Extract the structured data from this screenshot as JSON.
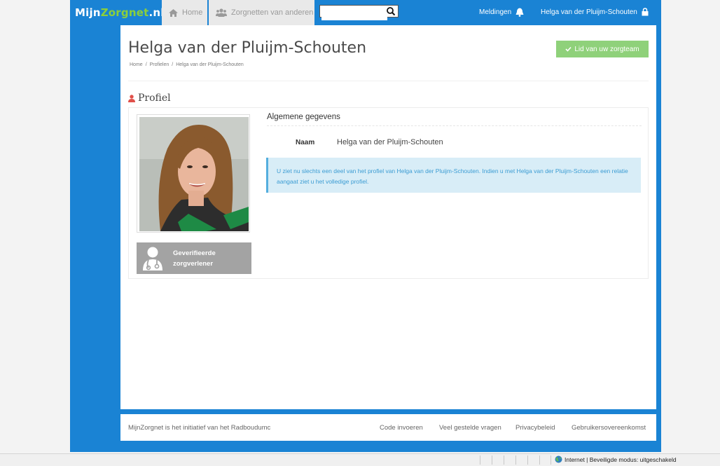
{
  "header": {
    "logo": {
      "part1": "Mijn",
      "part2": "Zorgnet",
      "part3": ".nl"
    },
    "nav": [
      {
        "label": "Home",
        "icon": "home-icon"
      },
      {
        "label": "Zorgnetten van anderen",
        "icon": "users-icon"
      }
    ],
    "search": {
      "value": "",
      "placeholder": ""
    },
    "notifications_label": "Meldingen",
    "user_label": "Helga van der Pluijm-Schouten"
  },
  "page": {
    "title": "Helga van der Pluijm-Schouten",
    "breadcrumb": [
      "Home",
      "Profielen",
      "Helga van der Pluijm-Schouten"
    ],
    "team_button": "Lid van uw zorgteam"
  },
  "profile": {
    "section_title": "Profiel",
    "verified_line1": "Geverifieerde",
    "verified_line2": "zorgverlener",
    "general_title": "Algemene gegevens",
    "name_label": "Naam",
    "name_value": "Helga van der Pluijm-Schouten",
    "info_text": "U ziet nu slechts een deel van het profiel van Helga van der Pluijm-Schouten. Indien u met Helga van der Pluijm-Schouten een relatie aangaat ziet u het volledige profiel."
  },
  "footer": {
    "initiative": "MijnZorgnet is het initiatief van het Radboudumc",
    "links": [
      "Code invoeren",
      "Veel gestelde vragen",
      "Privacybeleid",
      "Gebruikersovereenkomst"
    ]
  },
  "statusbar": {
    "text": "Internet | Beveiligde modus: uitgeschakeld"
  },
  "colors": {
    "brand_blue": "#1a83d4",
    "logo_green": "#8ccf3a",
    "success_green": "#8fd17a",
    "alert_bg": "#d8edf7",
    "alert_text": "#3b9cd3"
  }
}
